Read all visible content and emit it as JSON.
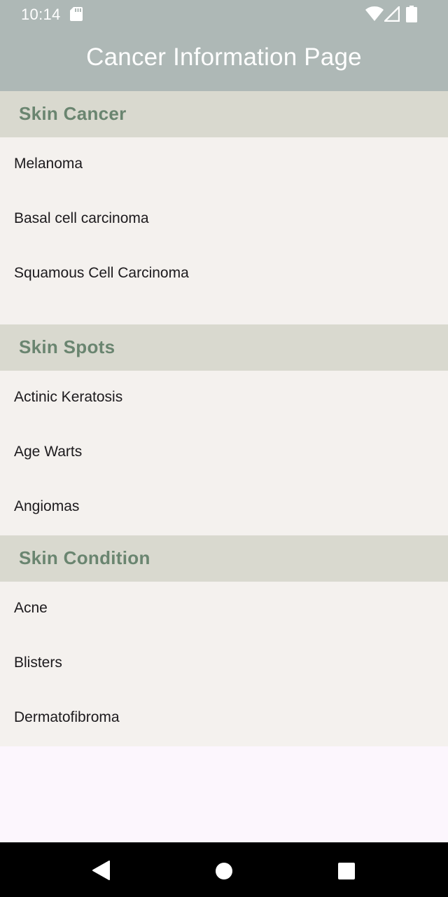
{
  "status_bar": {
    "time": "10:14",
    "icons": [
      "sd-card-icon",
      "wifi-icon",
      "cell-signal-icon",
      "battery-icon"
    ]
  },
  "app_bar": {
    "title": "Cancer Information Page"
  },
  "sections": [
    {
      "title": "Skin Cancer",
      "items": [
        "Melanoma",
        "Basal cell carcinoma",
        "Squamous Cell Carcinoma"
      ]
    },
    {
      "title": "Skin Spots",
      "items": [
        "Actinic Keratosis",
        "Age Warts",
        "Angiomas"
      ]
    },
    {
      "title": "Skin Condition",
      "items": [
        "Acne",
        "Blisters",
        "Dermatofibroma"
      ]
    }
  ],
  "nav_bar": {
    "icons": [
      "back-icon",
      "home-icon",
      "recents-icon"
    ]
  },
  "colors": {
    "app_bar": "#aeb8b6",
    "section_header_bg": "#d9d9cf",
    "section_header_text": "#6a8570",
    "list_bg": "#f4f1ee",
    "page_bg": "#fcf6fd"
  }
}
